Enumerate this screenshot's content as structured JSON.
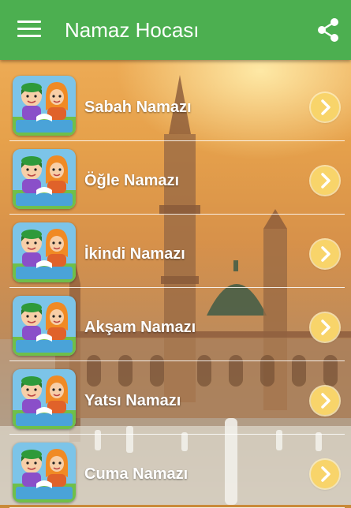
{
  "app_bar": {
    "title": "Namaz Hocası",
    "menu_icon": "menu-icon",
    "share_icon": "share-icon",
    "color": "#4caf50"
  },
  "background": {
    "icon": "mosque-background-image"
  },
  "prayers": [
    {
      "label": "Sabah Namazı"
    },
    {
      "label": "Öğle Namazı"
    },
    {
      "label": "İkindi Namazı"
    },
    {
      "label": "Akşam Namazı"
    },
    {
      "label": "Yatsı Namazı"
    },
    {
      "label": "Cuma Namazı"
    }
  ],
  "item_icons": {
    "thumbnail": "praying-children-icon",
    "arrow": "chevron-right-icon"
  },
  "colors": {
    "arrow_button": "#f8d46a",
    "label_text": "#ffffff"
  }
}
